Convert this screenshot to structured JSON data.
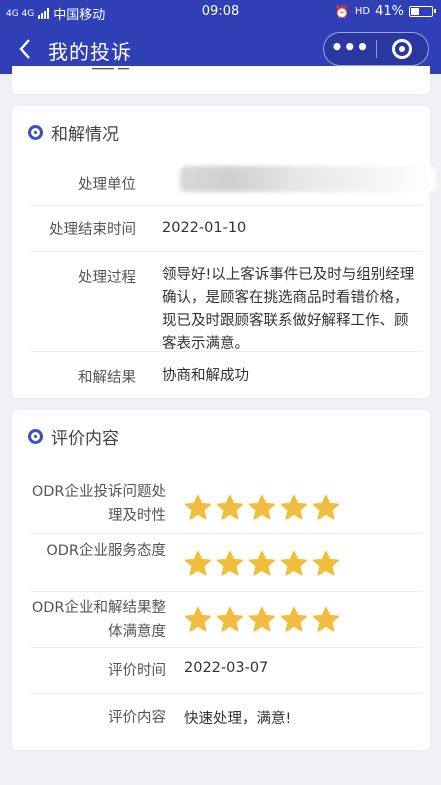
{
  "status_bar": {
    "network": "4G 4G",
    "carrier": "中国移动",
    "time": "09:08",
    "volte": "HD",
    "battery": "41%",
    "battery_level": 0.41
  },
  "nav": {
    "back_icon": "chevron-left-icon",
    "title": "我的投诉",
    "more_icon": "more-dots-icon",
    "close_icon": "target-close-icon"
  },
  "settlement": {
    "title": "和解情况",
    "rows": [
      {
        "label": "处理单位",
        "value": ""
      },
      {
        "label": "处理结束时间",
        "value": "2022-01-10"
      },
      {
        "label": "处理过程",
        "value": "领导好!以上客诉事件已及时与组别经理确认，是顾客在挑选商品时看错价格，现已及时跟顾客联系做好解释工作、顾客表示满意。"
      },
      {
        "label": "和解结果",
        "value": "协商和解成功"
      }
    ]
  },
  "evaluation": {
    "title": "评价内容",
    "ratings": [
      {
        "label": "ODR企业投诉问题处理及时性",
        "stars": 5,
        "max": 5
      },
      {
        "label": "ODR企业服务态度",
        "stars": 5,
        "max": 5
      },
      {
        "label": "ODR企业和解结果整体满意度",
        "stars": 5,
        "max": 5
      }
    ],
    "time_label": "评价时间",
    "time_value": "2022-03-07",
    "content_label": "评价内容",
    "content_value": "快速处理，满意!"
  },
  "colors": {
    "primary": "#2f3fb6",
    "accent": "#3b4fc7",
    "star": "#f3bd3b",
    "background": "#eef0f6"
  }
}
